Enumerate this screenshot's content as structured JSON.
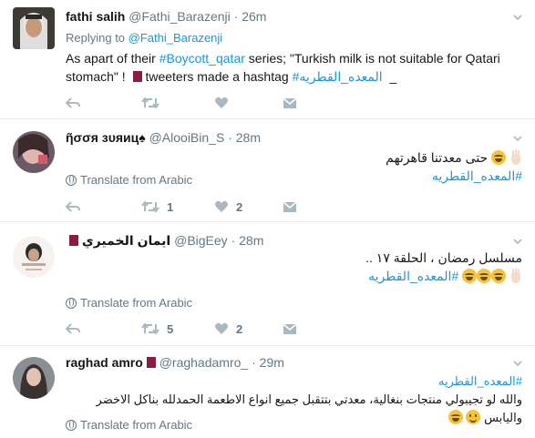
{
  "tweets": [
    {
      "name": "fathi salih",
      "handle": "@Fathi_Barazenji",
      "time": "26m",
      "replying_prefix": "Replying to ",
      "replying_handle": "@Fathi_Barazenji",
      "text_1": "As apart of their ",
      "text_hashtag": "#Boycott_qatar",
      "text_2": " series; \"Turkish milk is not suitable for Qatari",
      "text_3": "stomach\" ! ",
      "text_4": " tweeters made a hashtag ",
      "text_ar_hashtag": "#المعده_القطريه",
      "text_5": "_"
    },
    {
      "name": "ῆσσя зυяиц",
      "name_suffix": "♠",
      "handle": "@AlooiBin_S",
      "time": "28m",
      "text_ar": "حتى معدتنا قاهرتهم",
      "text_ar_hashtag": "#المعده_القطريه",
      "translate": "Translate from Arabic",
      "retweets": "1",
      "likes": "2"
    },
    {
      "name": "ايمان الخميري",
      "handle": "@BigEey",
      "time": "28m",
      "text_ar_line1": "مسلسل رمضان ، الحلقة ١٧ ..",
      "text_ar_hashtag": "#المعده_القطريه",
      "translate": "Translate from Arabic",
      "retweets": "5",
      "likes": "2"
    },
    {
      "name": "raghad amro",
      "handle": "@raghadamro_",
      "time": "29m",
      "text_ar_hashtag": "#المعده_القطريه",
      "text_ar_line2": "والله لو تجيبولي منتجات بنغالية، معدتي بتتقبل جميع انواع الاطعمة الحمدلله بناكل الاخضر واليابس",
      "translate": "Translate from Arabic"
    }
  ],
  "colors": {
    "link": "#1b95e0",
    "muted": "#657786",
    "icon": "#aab8c2",
    "qatar_flag": "#8d1b3d"
  },
  "icons": [
    "reply-icon",
    "retweet-icon",
    "like-icon",
    "dm-icon",
    "globe-icon",
    "caret-down-icon"
  ]
}
